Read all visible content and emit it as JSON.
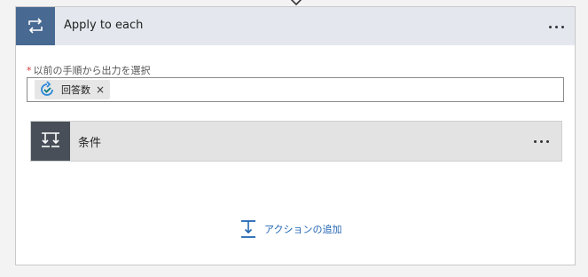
{
  "loop_card": {
    "title": "Apply to each",
    "icon": "loop-icon",
    "accent_color": "#486991",
    "more_icon": "ellipsis-icon"
  },
  "field": {
    "required_marker": "*",
    "label": "以前の手順から出力を選択",
    "token": {
      "label": "回答数",
      "icon": "forms-refresh-icon",
      "remove": "×"
    }
  },
  "condition_card": {
    "title": "条件",
    "icon": "condition-branch-icon",
    "accent_color": "#484f58",
    "more_icon": "ellipsis-icon"
  },
  "add_action": {
    "label": "アクションの追加",
    "icon": "add-action-icon",
    "color": "#2266b3"
  }
}
